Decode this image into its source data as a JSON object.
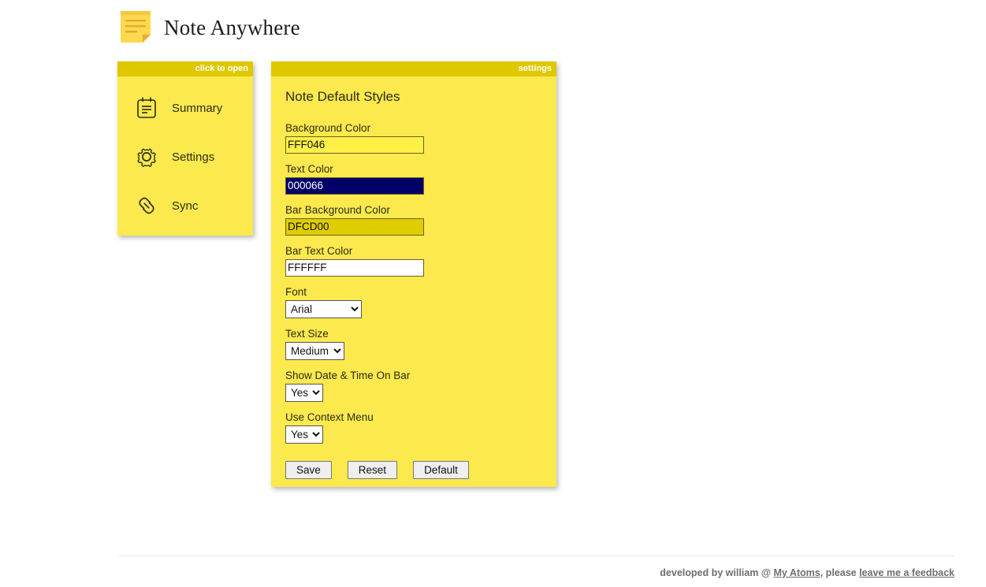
{
  "header": {
    "title": "Note Anywhere",
    "logo_icon": "sticky-note-icon"
  },
  "sidebar": {
    "titlebar_label": "click to open",
    "items": [
      {
        "label": "Summary",
        "icon": "notepad-icon"
      },
      {
        "label": "Settings",
        "icon": "gear-icon"
      },
      {
        "label": "Sync",
        "icon": "chain-link-icon"
      }
    ]
  },
  "settings": {
    "titlebar_label": "settings",
    "heading": "Note Default Styles",
    "fields": {
      "background_color": {
        "label": "Background Color",
        "value": "FFF046",
        "bg": "#FFF046",
        "fg": "#111111"
      },
      "text_color": {
        "label": "Text Color",
        "value": "000066",
        "bg": "#000066",
        "fg": "#FFFFFF"
      },
      "bar_background_color": {
        "label": "Bar Background Color",
        "value": "DFCD00",
        "bg": "#DFCD00",
        "fg": "#111111"
      },
      "bar_text_color": {
        "label": "Bar Text Color",
        "value": "FFFFFF",
        "bg": "#FFFFFF",
        "fg": "#111111"
      },
      "font": {
        "label": "Font",
        "value": "Arial"
      },
      "text_size": {
        "label": "Text Size",
        "value": "Medium"
      },
      "show_date_time_on_bar": {
        "label": "Show Date & Time On Bar",
        "value": "Yes"
      },
      "use_context_menu": {
        "label": "Use Context Menu",
        "value": "Yes"
      }
    },
    "buttons": {
      "save": "Save",
      "reset": "Reset",
      "default": "Default"
    }
  },
  "footer": {
    "text_before": "developed by william @ ",
    "link_1": "My Atoms",
    "text_middle": ", please ",
    "link_2": "leave me a feedback"
  },
  "colors": {
    "panel_body": "#FBE94E",
    "panel_titlebar": "#DFC800",
    "page_background": "#FFFFFF",
    "text": "#2B2B15"
  }
}
